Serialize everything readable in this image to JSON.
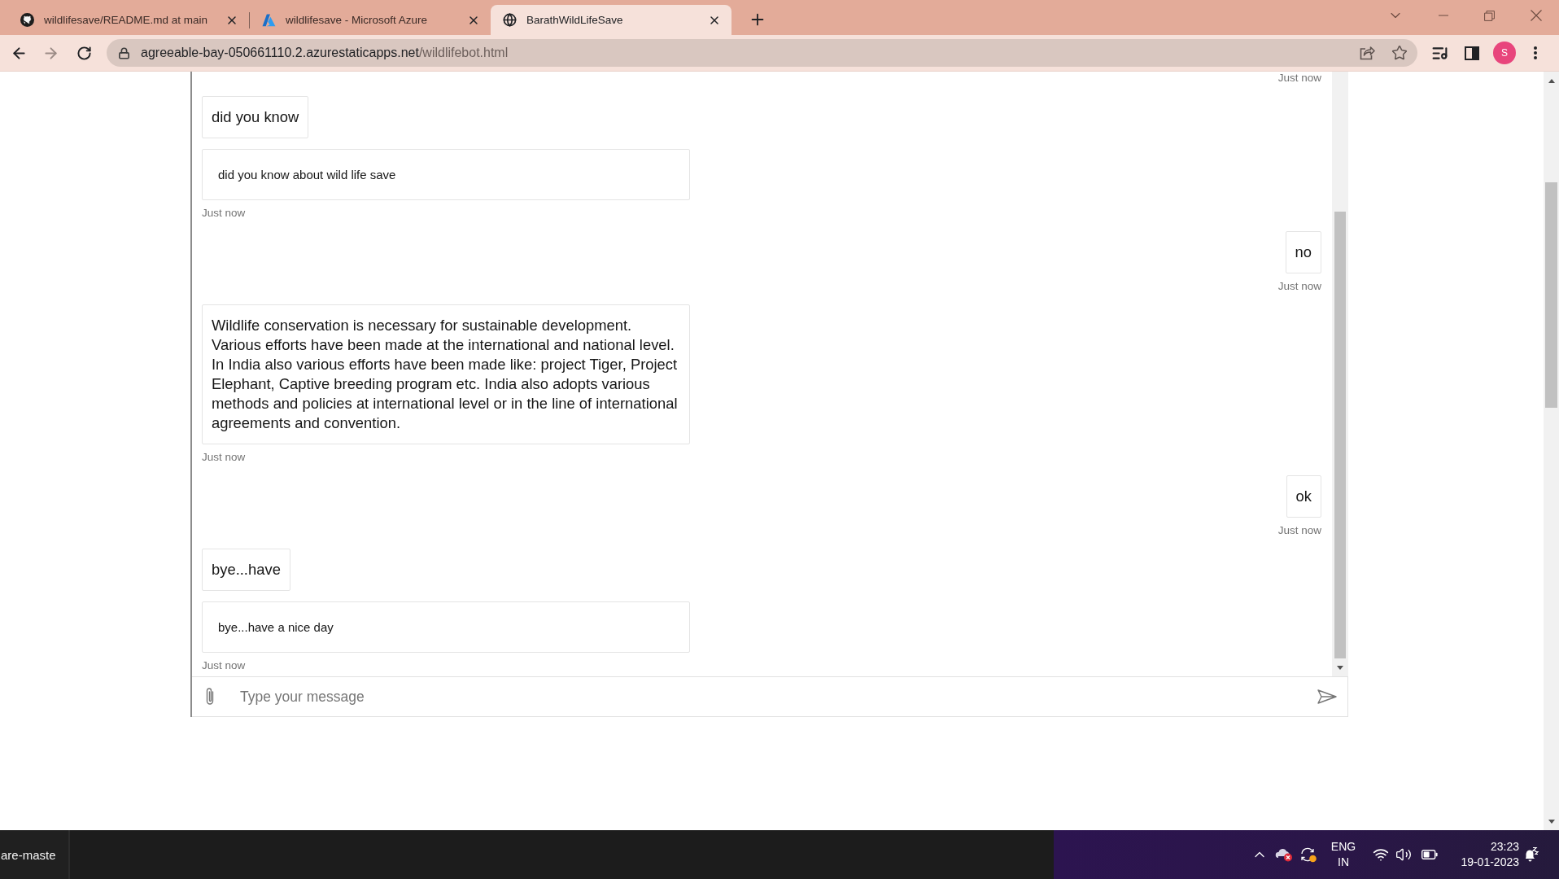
{
  "browser": {
    "tabs": [
      {
        "kind": "github",
        "title": "wildlifesave/README.md at main",
        "selected": false
      },
      {
        "kind": "azure",
        "title": "wildlifesave - Microsoft Azure",
        "selected": false
      },
      {
        "kind": "globe",
        "title": "BarathWildLifeSave",
        "selected": true
      }
    ],
    "address": {
      "host": "agreeable-bay-050661110.2.azurestaticapps.net",
      "path": "/wildlifebot.html"
    },
    "profile_initial": "S"
  },
  "chat": {
    "activities": [
      {
        "kind": "user",
        "time": "Just now"
      },
      {
        "kind": "bot",
        "bubbles": [
          {
            "kind": "text",
            "text": "did you know"
          },
          {
            "kind": "card",
            "text": "did you know about wild life save"
          }
        ],
        "time": "Just now"
      },
      {
        "kind": "user",
        "bubbles": [
          {
            "kind": "text",
            "text": "no"
          }
        ],
        "time": "Just now"
      },
      {
        "kind": "bot",
        "bubbles": [
          {
            "kind": "text",
            "text": "Wildlife conservation is necessary for sustainable development. Various efforts have been made at the international and national level. In India also various efforts have been made like: project Tiger, Project Elephant, Captive breeding program etc. India also adopts various methods and policies at international level or in the line of international agreements and convention."
          }
        ],
        "time": "Just now"
      },
      {
        "kind": "user",
        "bubbles": [
          {
            "kind": "text",
            "text": "ok"
          }
        ],
        "time": "Just now"
      },
      {
        "kind": "bot",
        "bubbles": [
          {
            "kind": "text",
            "text": "bye...have"
          },
          {
            "kind": "card",
            "text": "bye...have a nice day"
          }
        ],
        "time": "Just now"
      }
    ],
    "input": {
      "placeholder": "Type your message"
    }
  },
  "taskbar": {
    "window_title": "are-maste",
    "language": "ENG",
    "region": "IN",
    "time": "23:23",
    "date": "19-01-2023"
  }
}
